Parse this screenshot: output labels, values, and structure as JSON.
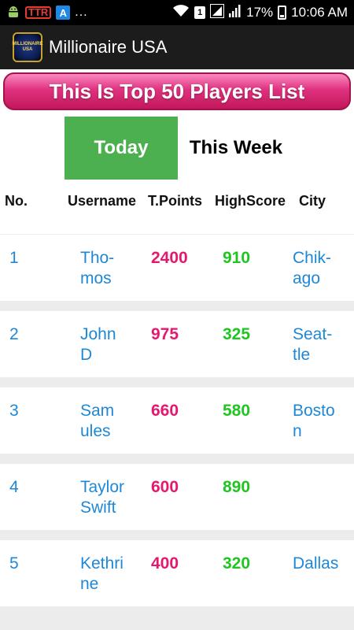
{
  "status_bar": {
    "dots": "...",
    "sim_slot": "1",
    "battery_percent": "17%",
    "time": "10:06 AM",
    "badge_text": "TTR",
    "app_a": "A"
  },
  "app_bar": {
    "logo_text": "MILLIONAIRE USA",
    "title": "Millionaire USA"
  },
  "banner": {
    "title": "This Is Top 50 Players List"
  },
  "tabs": [
    {
      "label": "Today",
      "selected": true
    },
    {
      "label": "This Week",
      "selected": false
    }
  ],
  "table": {
    "headers": [
      "No.",
      "Username",
      "T.Points",
      "HighScore",
      "City"
    ],
    "rows": [
      {
        "no": "1",
        "user_l1": "Tho-",
        "user_l2": "mos",
        "points": "2400",
        "high": "910",
        "city_l1": "Chik-",
        "city_l2": "ago"
      },
      {
        "no": "2",
        "user_l1": "John",
        "user_l2": "D",
        "points": "975",
        "high": "325",
        "city_l1": "Seat-",
        "city_l2": "tle"
      },
      {
        "no": "3",
        "user_l1": "Sam",
        "user_l2": "ules",
        "points": "660",
        "high": "580",
        "city_l1": "Bosto",
        "city_l2": "n"
      },
      {
        "no": "4",
        "user_l1": "Taylor",
        "user_l2": "Swift",
        "points": "600",
        "high": "890",
        "city_l1": "",
        "city_l2": ""
      },
      {
        "no": "5",
        "user_l1": "Kethri",
        "user_l2": "ne",
        "points": "400",
        "high": "320",
        "city_l1": "Dallas",
        "city_l2": ""
      }
    ]
  },
  "colors": {
    "tab_selected": "#4caf50",
    "points": "#e5186f",
    "highscore": "#21c521",
    "link": "#1e88d6",
    "banner": "#e0317f"
  }
}
